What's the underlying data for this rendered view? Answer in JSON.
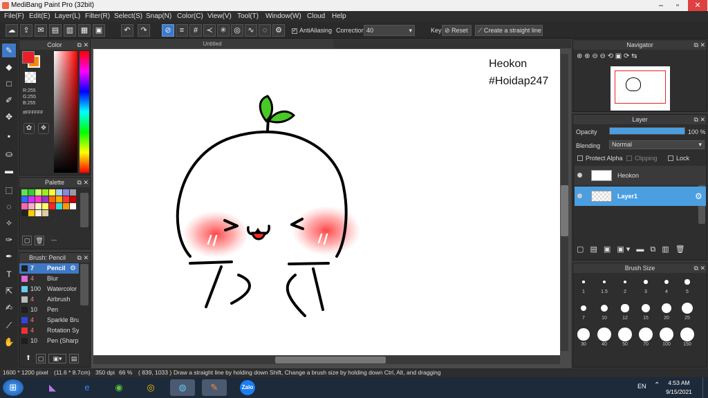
{
  "window": {
    "title": "MediBang Paint Pro (32bit)",
    "minimize": "–",
    "maximize": "▫",
    "close": "✕"
  },
  "menu": [
    "File(F)",
    "Edit(E)",
    "Layer(L)",
    "Filter(R)",
    "Select(S)",
    "Snap(N)",
    "Color(C)",
    "View(V)",
    "Tool(T)",
    "Window(W)",
    "Cloud",
    "Help"
  ],
  "toolbar": {
    "antialiasing_label": "AntiAliasing",
    "correction_label": "Correction",
    "correction_value": "40",
    "key_label": "Key",
    "reset_label": "Reset",
    "straight_line_label": "Create a straight line"
  },
  "canvas": {
    "tab_title": "Untitled",
    "text_line1": "Heokon",
    "text_line2": "#Hoidap247"
  },
  "color_panel": {
    "title": "Color",
    "r": "R:255",
    "g": "G:255",
    "b": "B:255",
    "hex": "#FFFFFF"
  },
  "palette_panel": {
    "title": "Palette",
    "footer": "---"
  },
  "brush_panel": {
    "title": "Brush: Pencil",
    "items": [
      {
        "size": "7",
        "name": "Pencil",
        "color": "#1e1e1e"
      },
      {
        "size": "4",
        "name": "Blur",
        "color": "#e06bd6"
      },
      {
        "size": "100",
        "name": "Watercolor",
        "color": "#66ccee"
      },
      {
        "size": "4",
        "name": "Airbrush",
        "color": "#bbbbbb"
      },
      {
        "size": "10",
        "name": "Pen",
        "color": "#1e1e1e"
      },
      {
        "size": "4",
        "name": "Sparkle Brush",
        "color": "#3344dd"
      },
      {
        "size": "4",
        "name": "Rotation Sym",
        "color": "#ee3333"
      },
      {
        "size": "10",
        "name": "Pen (Sharp)",
        "color": "#1e1e1e"
      }
    ]
  },
  "navigator_panel": {
    "title": "Navigator"
  },
  "layer_panel": {
    "title": "Layer",
    "opacity_label": "Opacity",
    "opacity_value": "100 %",
    "opacity_fraction": 1.0,
    "blending_label": "Blending",
    "blending_value": "Normal",
    "protect_alpha": "Protect Alpha",
    "clipping": "Clipping",
    "lock": "Lock",
    "layers": [
      {
        "name": "Heokon",
        "selected": false
      },
      {
        "name": "Layer1",
        "selected": true
      }
    ]
  },
  "brush_size_panel": {
    "title": "Brush Size",
    "sizes": [
      "1",
      "1.5",
      "2",
      "3",
      "4",
      "5",
      "7",
      "10",
      "12",
      "15",
      "20",
      "25",
      "30",
      "40",
      "50",
      "70",
      "100",
      "150"
    ]
  },
  "status": {
    "dimensions": "1600 * 1200 pixel",
    "physical": "(11.6 * 8.7cm)",
    "dpi": "350 dpi",
    "zoom": "66 %",
    "coords": "( 839, 1033 )",
    "hint": "Draw a straight line by holding down Shift, Change a brush size by holding down Ctrl, Alt, and dragging"
  },
  "taskbar": {
    "lang": "EN",
    "time": "4:53 AM",
    "date": "9/15/2021",
    "zalo": "Zalo"
  },
  "colors": {
    "accent": "#3f78c7",
    "fg_color": "#e8202a",
    "bg_color": "#ff8a00",
    "blush": "#ff4d4d",
    "sprout": "#49c926"
  }
}
